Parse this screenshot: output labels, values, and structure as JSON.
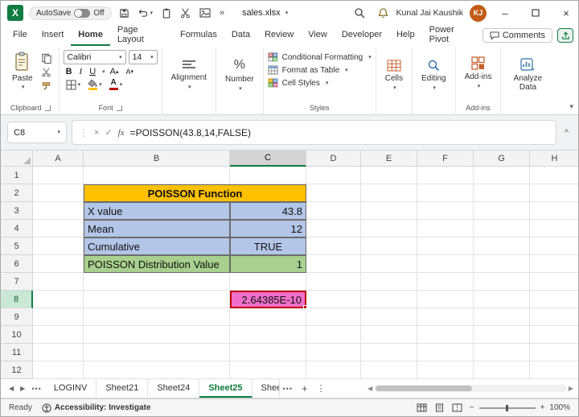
{
  "titlebar": {
    "app_name": "Excel",
    "autosave_label": "AutoSave",
    "autosave_state": "Off",
    "filename": "sales.xlsx",
    "user_name": "Kunal Jai Kaushik",
    "user_initials": "KJ"
  },
  "ribbon": {
    "tabs": [
      "File",
      "Insert",
      "Home",
      "Page Layout",
      "Formulas",
      "Data",
      "Review",
      "View",
      "Developer",
      "Help",
      "Power Pivot"
    ],
    "active_tab": "Home",
    "comments_label": "Comments",
    "paste_label": "Paste",
    "clipboard_group": "Clipboard",
    "font_name": "Calibri",
    "font_size": "14",
    "bold_label": "B",
    "italic_label": "I",
    "underline_label": "U",
    "font_group": "Font",
    "alignment_label": "Alignment",
    "number_label": "Number",
    "percent_glyph": "%",
    "conditional_formatting_label": "Conditional Formatting",
    "format_as_table_label": "Format as Table",
    "cell_styles_label": "Cell Styles",
    "styles_group": "Styles",
    "cells_label": "Cells",
    "editing_label": "Editing",
    "addins_label": "Add-ins",
    "addins_group": "Add-ins",
    "analyze_data_label": "Analyze Data"
  },
  "formula_bar": {
    "name_box": "C8",
    "fx_label": "fx",
    "formula": "=POISSON(43.8,14,FALSE)"
  },
  "grid": {
    "columns": [
      "A",
      "B",
      "C",
      "D",
      "E",
      "F",
      "G",
      "H"
    ],
    "rows": [
      "1",
      "2",
      "3",
      "4",
      "5",
      "6",
      "7",
      "8",
      "9",
      "10",
      "11",
      "12"
    ],
    "selected_cell": "C8"
  },
  "sheet": {
    "cells": [
      {
        "ref": "B2",
        "text": "POISSON Function",
        "style": "header",
        "span": 2,
        "align": "center"
      },
      {
        "ref": "B3",
        "text": "X value",
        "style": "label-blue"
      },
      {
        "ref": "C3",
        "text": "43.8",
        "style": "value-blue",
        "align": "right"
      },
      {
        "ref": "B4",
        "text": "Mean",
        "style": "label-blue"
      },
      {
        "ref": "C4",
        "text": "12",
        "style": "value-blue",
        "align": "right"
      },
      {
        "ref": "B5",
        "text": "Cumulative",
        "style": "label-blue"
      },
      {
        "ref": "C5",
        "text": "TRUE",
        "style": "value-blue",
        "align": "center"
      },
      {
        "ref": "B6",
        "text": "POISSON Distribution Value",
        "style": "label-green"
      },
      {
        "ref": "C6",
        "text": "1",
        "style": "value-green",
        "align": "right"
      },
      {
        "ref": "C8",
        "text": "2.64385E-10",
        "style": "result",
        "align": "right"
      }
    ]
  },
  "sheet_tabs": {
    "tabs": [
      "LOGINV",
      "Sheet21",
      "Sheet24",
      "Sheet25",
      "Shee"
    ],
    "active": "Sheet25"
  },
  "status_bar": {
    "ready_label": "Ready",
    "accessibility_label": "Accessibility: Investigate",
    "zoom_level": "100%"
  },
  "colors": {
    "accent_green": "#107C41",
    "header_orange": "#FFC000",
    "row_blue": "#B4C6E7",
    "row_green": "#A9D08E",
    "result_pink": "#F06FC8",
    "selection_border": "#C00000",
    "avatar_bg": "#C05C17"
  }
}
